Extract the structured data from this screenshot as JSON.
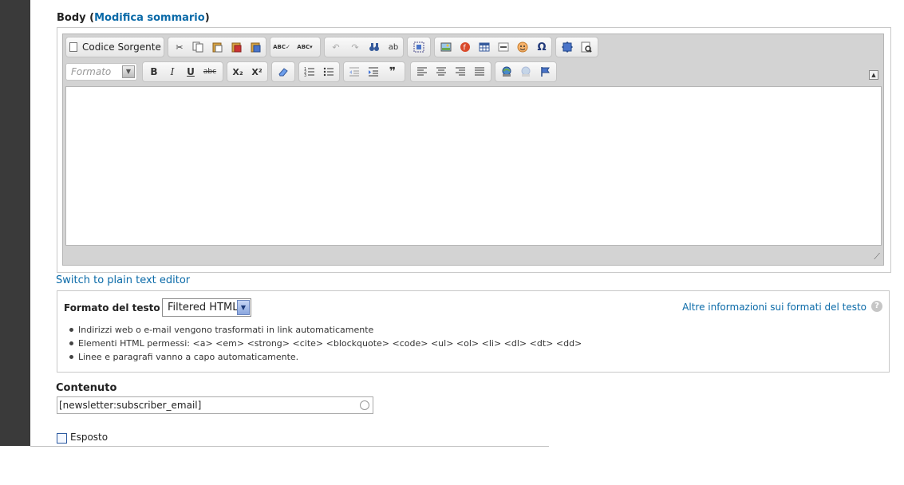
{
  "body_field": {
    "label": "Body (",
    "link": "Modifica sommario",
    "label_end": ")"
  },
  "toolbar": {
    "source_button": "Codice Sorgente",
    "format_placeholder": "Formato",
    "row1_icons": [
      "cut-icon",
      "copy-icon",
      "paste-icon",
      "paste-text-icon",
      "paste-word-icon",
      "spellcheck-icon",
      "spellcheck-menu-icon",
      "undo-icon",
      "redo-icon",
      "find-icon",
      "replace-icon",
      "select-all-icon",
      "image-icon",
      "flash-icon",
      "table-icon",
      "horizontal-rule-icon",
      "smiley-icon",
      "special-char-icon",
      "maximize-icon",
      "preview-icon"
    ],
    "row2_icons": [
      "bold-icon",
      "italic-icon",
      "underline-icon",
      "strike-icon",
      "subscript-icon",
      "superscript-icon",
      "remove-format-icon",
      "numbered-list-icon",
      "bulleted-list-icon",
      "outdent-icon",
      "indent-icon",
      "blockquote-icon",
      "align-left-icon",
      "align-center-icon",
      "align-right-icon",
      "align-justify-icon",
      "link-icon",
      "unlink-icon",
      "anchor-icon"
    ],
    "glyphs": {
      "bold": "B",
      "italic": "I",
      "underline": "U",
      "strike": "abc",
      "subscript": "X₂",
      "superscript": "X²",
      "blockquote": "❞",
      "special": "Ω"
    }
  },
  "switch_link": "Switch to plain text editor",
  "text_format": {
    "label": "Formato del testo",
    "selected": "Filtered HTML",
    "more_link": "Altre informazioni sui formati del testo",
    "tips": [
      "Indirizzi web o e-mail vengono trasformati in link automaticamente",
      "Elementi HTML permessi: <a> <em> <strong> <cite> <blockquote> <code> <ul> <ol> <li> <dl> <dt> <dd>",
      "Linee e paragrafi vanno a capo automaticamente."
    ]
  },
  "contenuto": {
    "label": "Contenuto",
    "value": "[newsletter:subscriber_email]"
  },
  "esposto": {
    "label": "Esposto",
    "checked": false
  }
}
